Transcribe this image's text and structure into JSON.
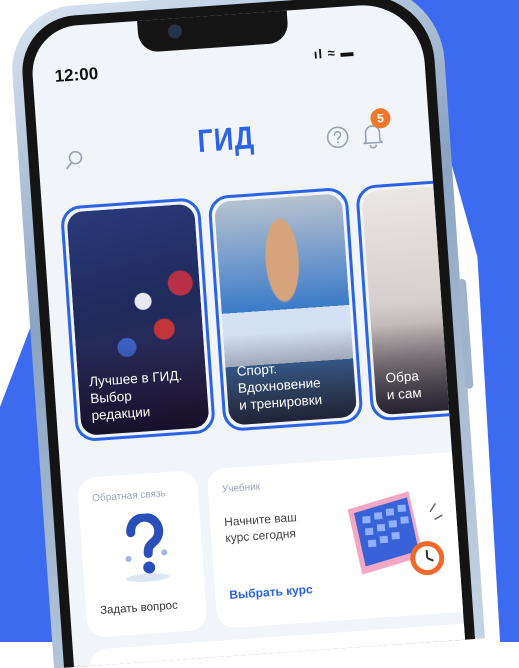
{
  "status": {
    "time": "12:00",
    "icons": "ıl ≈ ▬"
  },
  "header": {
    "logo": "ГИД",
    "notification_count": "5"
  },
  "stories": [
    {
      "lines": [
        "Лучшее в ГИД.",
        "Выбор",
        "редакции"
      ]
    },
    {
      "lines": [
        "Спорт.",
        "Вдохновение",
        "и тренировки"
      ]
    },
    {
      "lines": [
        "Обра",
        "и сам"
      ]
    }
  ],
  "cards": {
    "feedback": {
      "label": "Обратная связь",
      "action": "Задать вопрос"
    },
    "course": {
      "label": "Учебник",
      "text_lines": [
        "Начните ваш",
        "курс сегодня"
      ],
      "action": "Выбрать курс"
    }
  },
  "colors": {
    "accent": "#2a63e8",
    "badge": "#f0782a",
    "backdrop": "#3d6bf0"
  }
}
